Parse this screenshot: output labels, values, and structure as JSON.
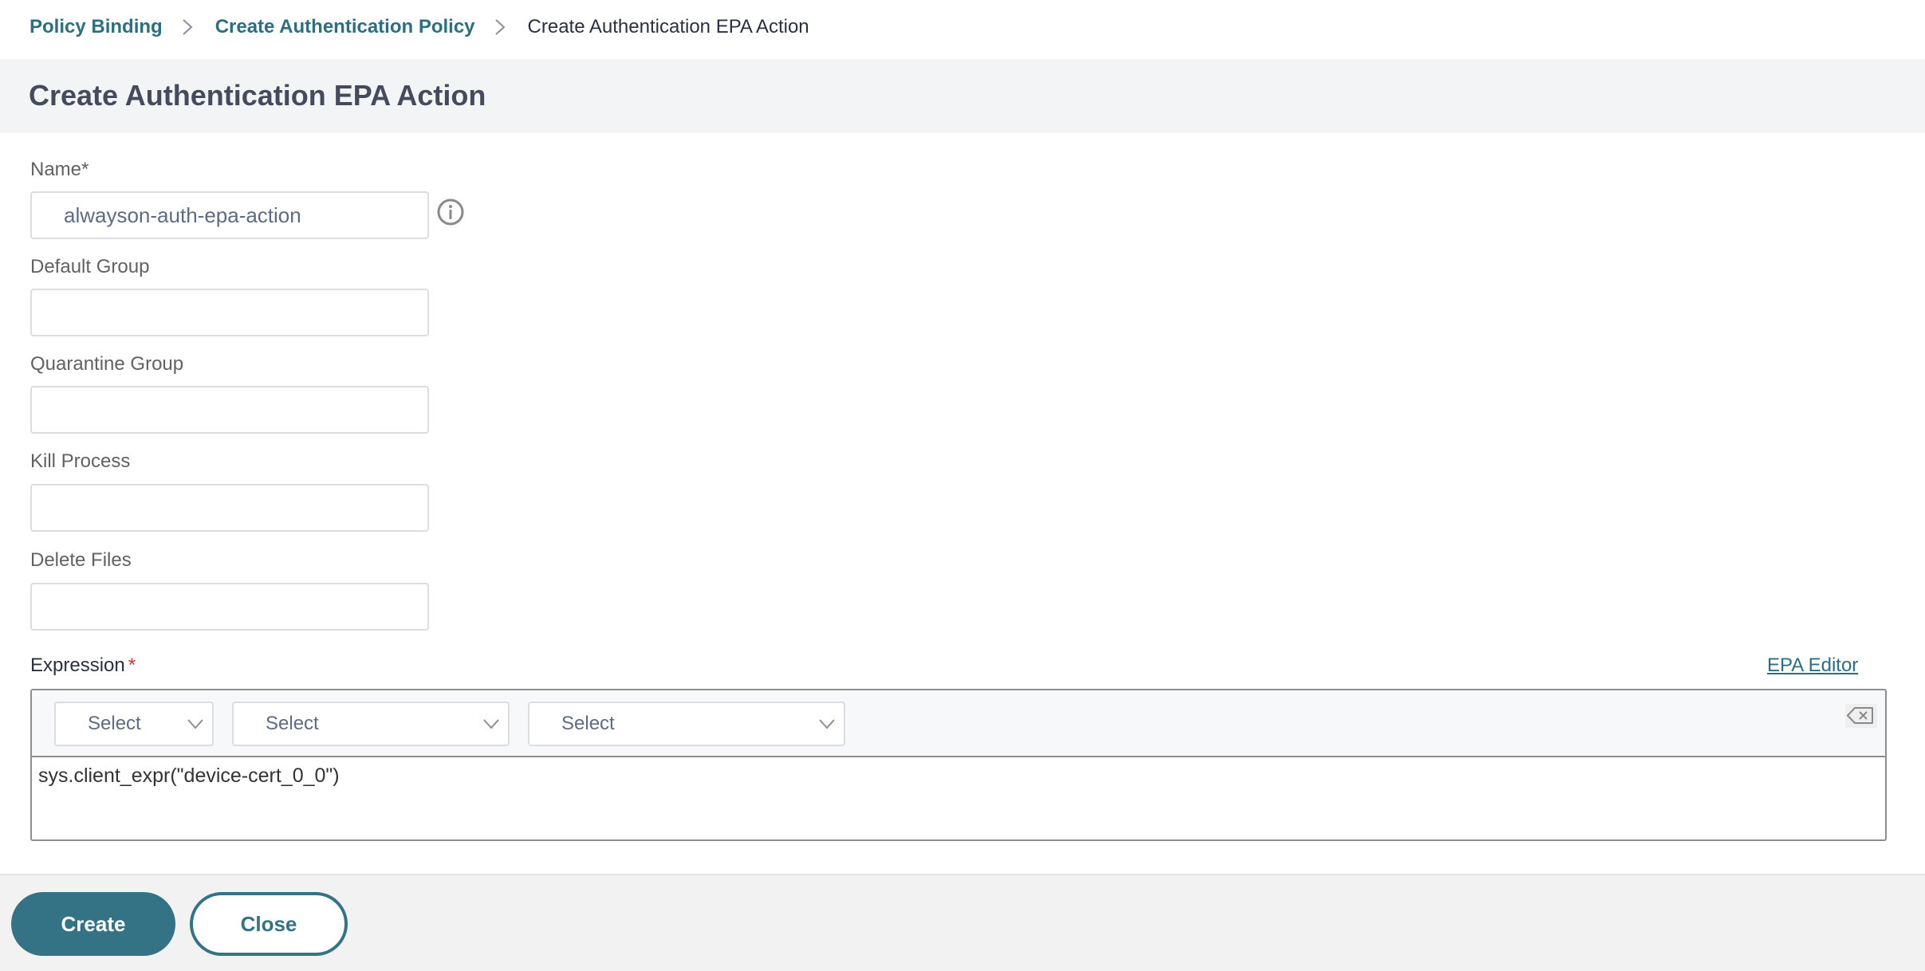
{
  "breadcrumb": {
    "items": [
      {
        "label": "Policy Binding",
        "link": true
      },
      {
        "label": "Create Authentication Policy",
        "link": true
      },
      {
        "label": "Create Authentication EPA Action",
        "link": false
      }
    ]
  },
  "header": {
    "title": "Create Authentication EPA Action"
  },
  "form": {
    "name": {
      "label": "Name*",
      "value": "alwayson-auth-epa-action",
      "placeholder": ""
    },
    "default_group": {
      "label": "Default Group",
      "value": "",
      "placeholder": ""
    },
    "quarantine_group": {
      "label": "Quarantine Group",
      "value": "",
      "placeholder": ""
    },
    "kill_process": {
      "label": "Kill Process",
      "value": "",
      "placeholder": ""
    },
    "delete_files": {
      "label": "Delete Files",
      "value": "",
      "placeholder": ""
    },
    "info_icon": "info-icon"
  },
  "expression": {
    "label": "Expression",
    "required_mark": "*",
    "editor_link": "EPA Editor",
    "selects": [
      {
        "selected": "Select"
      },
      {
        "selected": "Select"
      },
      {
        "selected": "Select"
      }
    ],
    "clear_icon": "backspace-clear-icon",
    "value": "sys.client_expr(\"device-cert_0_0\")"
  },
  "footer": {
    "create_label": "Create",
    "close_label": "Close"
  },
  "colors": {
    "accent": "#347285",
    "link": "#2d6e80",
    "required": "#d0342c",
    "header_bg": "#f3f4f6",
    "footer_bg": "#f2f2f2"
  }
}
